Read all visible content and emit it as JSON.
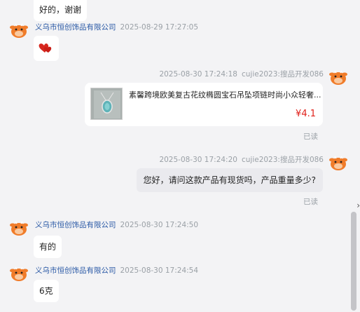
{
  "messages": [
    {
      "id": "m0",
      "bubble_text": "好的，谢谢"
    },
    {
      "id": "m1",
      "sender": "义乌市恒创饰品有限公司",
      "time": "2025-08-29 17:27:05",
      "emoji": "hearts"
    },
    {
      "id": "m2",
      "time": "2025-08-30 17:24:18",
      "sender": "cujie2023:搜品开发086",
      "product": {
        "title": "素馨跨境欧美复古花纹椭圆宝石吊坠项链时尚小众轻奢...",
        "price": "¥4.1"
      },
      "read_label": "已读"
    },
    {
      "id": "m3",
      "time": "2025-08-30 17:24:20",
      "sender": "cujie2023:搜品开发086",
      "bubble_text": "您好，请问这款产品有现货吗，产品重量多少?",
      "read_label": "已读"
    },
    {
      "id": "m4",
      "sender": "义乌市恒创饰品有限公司",
      "time": "2025-08-30 17:24:50",
      "bubble_text": "有的"
    },
    {
      "id": "m5",
      "sender": "义乌市恒创饰品有限公司",
      "time": "2025-08-30 17:24:54",
      "bubble_text": "6克"
    }
  ],
  "colors": {
    "accent_link": "#2b5aa6",
    "price_red": "#e0201a",
    "background": "#f3f3f5",
    "avatar_orange": "#f07c2a"
  },
  "icons": {
    "avatar": "cartoon-cow-avatar-icon",
    "emoji": "two-hearts-icon",
    "edge": "chevron-right-icon"
  },
  "edge_glyph": "›"
}
